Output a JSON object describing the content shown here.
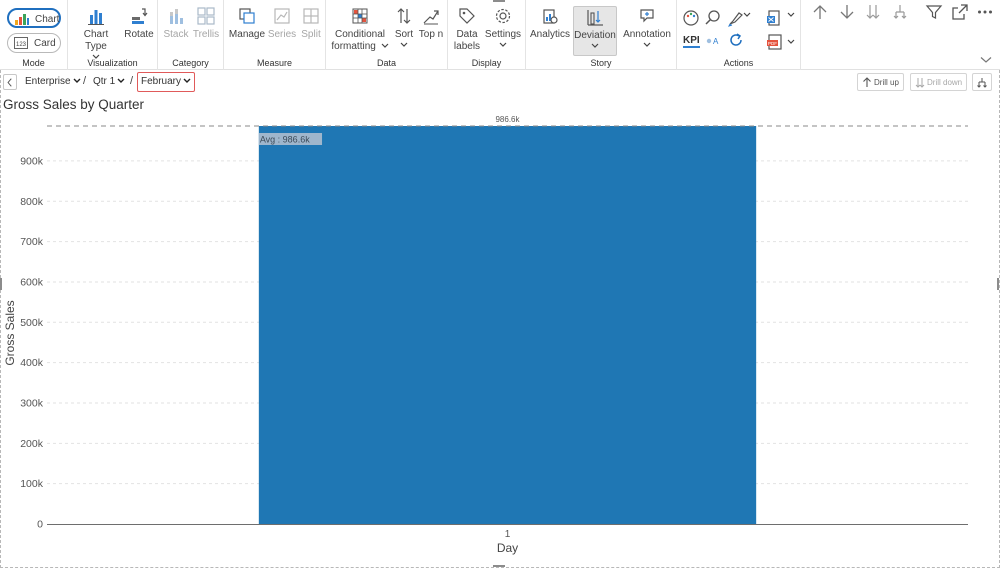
{
  "ribbon": {
    "mode": {
      "label": "Mode",
      "chart_label": "Chart",
      "card_label": "Card",
      "selected": "Chart"
    },
    "visualization": {
      "label": "Visualization",
      "chart_type": "Chart Type",
      "rotate": "Rotate"
    },
    "category": {
      "label": "Category",
      "stack": "Stack",
      "trellis": "Trellis"
    },
    "measure": {
      "label": "Measure",
      "manage": "Manage",
      "series": "Series",
      "split": "Split"
    },
    "data": {
      "label": "Data",
      "conditional_line1": "Conditional",
      "conditional_line2": "formatting",
      "sort": "Sort",
      "top_n": "Top n"
    },
    "display": {
      "label": "Display",
      "data_labels_line1": "Data",
      "data_labels_line2": "labels",
      "settings": "Settings"
    },
    "story": {
      "label": "Story",
      "analytics": "Analytics",
      "deviation": "Deviation",
      "annotation": "Annotation"
    },
    "actions": {
      "label": "Actions",
      "kpi": "KPI",
      "icons": [
        "palette-icon",
        "search-icon",
        "paint-brush-icon",
        "rename-icon",
        "refresh-icon",
        "export-excel-icon",
        "export-pdf-icon"
      ]
    },
    "toolbar_icons": [
      "arrow-up-icon",
      "arrow-down-icon",
      "double-arrow-down-icon",
      "split-arrow-icon",
      "filter-icon",
      "expand-icon",
      "more-icon"
    ]
  },
  "breadcrumb": {
    "items": [
      "Enterprise",
      "Qtr 1",
      "February"
    ],
    "separator": "/"
  },
  "drill": {
    "drill_up": "Drill up",
    "drill_down": "Drill down"
  },
  "chart_title": "Gross Sales by Quarter",
  "colors": {
    "bar": "#1f77b4",
    "accent": "#1f6fbf",
    "highlight_border": "#e05a5a"
  },
  "chart_data": {
    "type": "bar",
    "title": "Gross Sales by Quarter",
    "xlabel": "Day",
    "ylabel": "Gross Sales",
    "categories": [
      "1"
    ],
    "values": [
      986600
    ],
    "value_labels": [
      "986.6k"
    ],
    "ylim": [
      0,
      986600
    ],
    "yticks": [
      0,
      100000,
      200000,
      300000,
      400000,
      500000,
      600000,
      700000,
      800000,
      900000
    ],
    "ytick_labels": [
      "0",
      "100k",
      "200k",
      "300k",
      "400k",
      "500k",
      "600k",
      "700k",
      "800k",
      "900k"
    ],
    "average_line": {
      "value": 986600,
      "label": "Avg : 986.6k",
      "style": "dashed"
    },
    "grid": true,
    "legend": "none"
  }
}
